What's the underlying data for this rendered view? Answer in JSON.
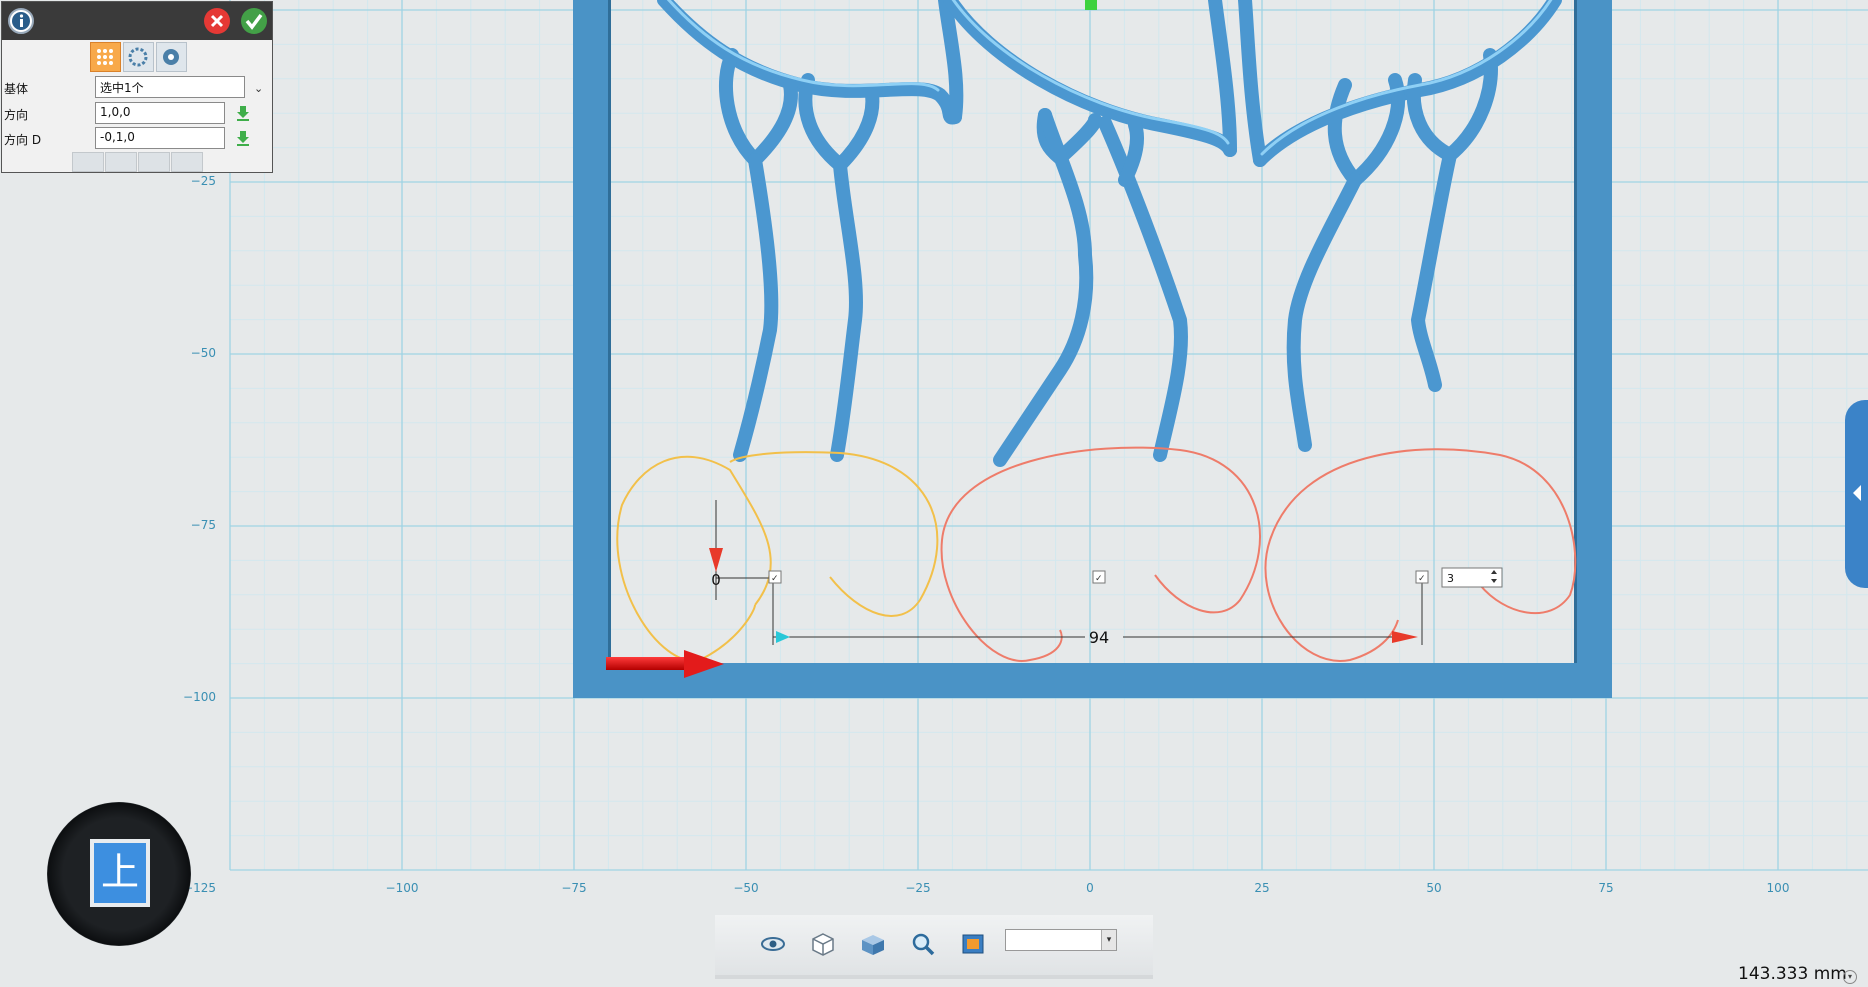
{
  "panel": {
    "rows": [
      {
        "label": "基体",
        "value": "选中1个"
      },
      {
        "label": "方向",
        "value": "1,0,0"
      },
      {
        "label": "方向  D",
        "value": "-0,1,0"
      }
    ]
  },
  "axes": {
    "x_ticks": [
      "−100",
      "−75",
      "−50",
      "−25",
      "0",
      "25",
      "50",
      "75",
      "100"
    ],
    "y_ticks": [
      "−25",
      "−50",
      "−75",
      "−100",
      "−125"
    ]
  },
  "annotations": {
    "origin_label": "0",
    "distance_label": "94",
    "count_value": "3",
    "check_mark": "✓"
  },
  "view_cube": {
    "face_label": "上"
  },
  "status": {
    "measurement": "143.333 mm"
  },
  "toolbar": {
    "icons": [
      "eye-icon",
      "wire-cube-icon",
      "solid-cube-icon",
      "zoom-icon",
      "render-icon"
    ],
    "view_select_value": ""
  },
  "colors": {
    "frame": "#4a93c6",
    "tube": "#4b97d0",
    "grid_major": "#9fd4e4",
    "grid_minor": "#d3e8ee",
    "yellow_curve": "#f2c04a",
    "red_curve": "#ee7c6a",
    "background": "#e6e9ea"
  }
}
